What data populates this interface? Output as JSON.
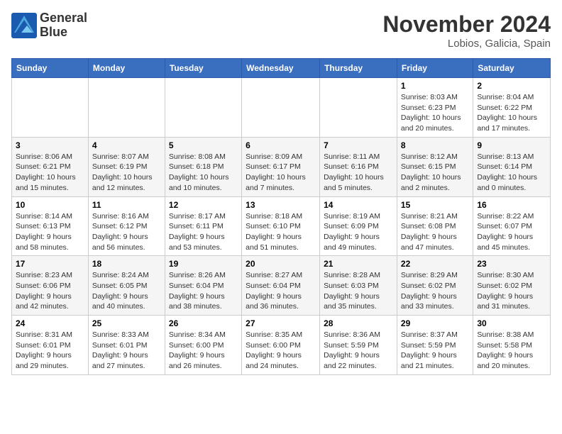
{
  "header": {
    "logo_line1": "General",
    "logo_line2": "Blue",
    "month": "November 2024",
    "location": "Lobios, Galicia, Spain"
  },
  "weekdays": [
    "Sunday",
    "Monday",
    "Tuesday",
    "Wednesday",
    "Thursday",
    "Friday",
    "Saturday"
  ],
  "weeks": [
    [
      {
        "day": "",
        "info": ""
      },
      {
        "day": "",
        "info": ""
      },
      {
        "day": "",
        "info": ""
      },
      {
        "day": "",
        "info": ""
      },
      {
        "day": "",
        "info": ""
      },
      {
        "day": "1",
        "info": "Sunrise: 8:03 AM\nSunset: 6:23 PM\nDaylight: 10 hours and 20 minutes."
      },
      {
        "day": "2",
        "info": "Sunrise: 8:04 AM\nSunset: 6:22 PM\nDaylight: 10 hours and 17 minutes."
      }
    ],
    [
      {
        "day": "3",
        "info": "Sunrise: 8:06 AM\nSunset: 6:21 PM\nDaylight: 10 hours and 15 minutes."
      },
      {
        "day": "4",
        "info": "Sunrise: 8:07 AM\nSunset: 6:19 PM\nDaylight: 10 hours and 12 minutes."
      },
      {
        "day": "5",
        "info": "Sunrise: 8:08 AM\nSunset: 6:18 PM\nDaylight: 10 hours and 10 minutes."
      },
      {
        "day": "6",
        "info": "Sunrise: 8:09 AM\nSunset: 6:17 PM\nDaylight: 10 hours and 7 minutes."
      },
      {
        "day": "7",
        "info": "Sunrise: 8:11 AM\nSunset: 6:16 PM\nDaylight: 10 hours and 5 minutes."
      },
      {
        "day": "8",
        "info": "Sunrise: 8:12 AM\nSunset: 6:15 PM\nDaylight: 10 hours and 2 minutes."
      },
      {
        "day": "9",
        "info": "Sunrise: 8:13 AM\nSunset: 6:14 PM\nDaylight: 10 hours and 0 minutes."
      }
    ],
    [
      {
        "day": "10",
        "info": "Sunrise: 8:14 AM\nSunset: 6:13 PM\nDaylight: 9 hours and 58 minutes."
      },
      {
        "day": "11",
        "info": "Sunrise: 8:16 AM\nSunset: 6:12 PM\nDaylight: 9 hours and 56 minutes."
      },
      {
        "day": "12",
        "info": "Sunrise: 8:17 AM\nSunset: 6:11 PM\nDaylight: 9 hours and 53 minutes."
      },
      {
        "day": "13",
        "info": "Sunrise: 8:18 AM\nSunset: 6:10 PM\nDaylight: 9 hours and 51 minutes."
      },
      {
        "day": "14",
        "info": "Sunrise: 8:19 AM\nSunset: 6:09 PM\nDaylight: 9 hours and 49 minutes."
      },
      {
        "day": "15",
        "info": "Sunrise: 8:21 AM\nSunset: 6:08 PM\nDaylight: 9 hours and 47 minutes."
      },
      {
        "day": "16",
        "info": "Sunrise: 8:22 AM\nSunset: 6:07 PM\nDaylight: 9 hours and 45 minutes."
      }
    ],
    [
      {
        "day": "17",
        "info": "Sunrise: 8:23 AM\nSunset: 6:06 PM\nDaylight: 9 hours and 42 minutes."
      },
      {
        "day": "18",
        "info": "Sunrise: 8:24 AM\nSunset: 6:05 PM\nDaylight: 9 hours and 40 minutes."
      },
      {
        "day": "19",
        "info": "Sunrise: 8:26 AM\nSunset: 6:04 PM\nDaylight: 9 hours and 38 minutes."
      },
      {
        "day": "20",
        "info": "Sunrise: 8:27 AM\nSunset: 6:04 PM\nDaylight: 9 hours and 36 minutes."
      },
      {
        "day": "21",
        "info": "Sunrise: 8:28 AM\nSunset: 6:03 PM\nDaylight: 9 hours and 35 minutes."
      },
      {
        "day": "22",
        "info": "Sunrise: 8:29 AM\nSunset: 6:02 PM\nDaylight: 9 hours and 33 minutes."
      },
      {
        "day": "23",
        "info": "Sunrise: 8:30 AM\nSunset: 6:02 PM\nDaylight: 9 hours and 31 minutes."
      }
    ],
    [
      {
        "day": "24",
        "info": "Sunrise: 8:31 AM\nSunset: 6:01 PM\nDaylight: 9 hours and 29 minutes."
      },
      {
        "day": "25",
        "info": "Sunrise: 8:33 AM\nSunset: 6:01 PM\nDaylight: 9 hours and 27 minutes."
      },
      {
        "day": "26",
        "info": "Sunrise: 8:34 AM\nSunset: 6:00 PM\nDaylight: 9 hours and 26 minutes."
      },
      {
        "day": "27",
        "info": "Sunrise: 8:35 AM\nSunset: 6:00 PM\nDaylight: 9 hours and 24 minutes."
      },
      {
        "day": "28",
        "info": "Sunrise: 8:36 AM\nSunset: 5:59 PM\nDaylight: 9 hours and 22 minutes."
      },
      {
        "day": "29",
        "info": "Sunrise: 8:37 AM\nSunset: 5:59 PM\nDaylight: 9 hours and 21 minutes."
      },
      {
        "day": "30",
        "info": "Sunrise: 8:38 AM\nSunset: 5:58 PM\nDaylight: 9 hours and 20 minutes."
      }
    ]
  ]
}
